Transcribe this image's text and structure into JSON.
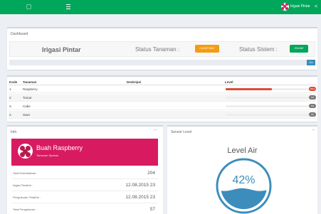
{
  "navbar": {
    "user_name": "Irigasi Pintar",
    "share_icon": "share-icon"
  },
  "dashboard": {
    "section_title": "Dashboard",
    "brand": "Irigasi Pintar",
    "status_tanaman_label": "Status Tanaman :",
    "status_tanaman_value": "CUKUP BAIK",
    "status_sistem_label": "Status Sistem :",
    "status_sistem_value": "ONLINE",
    "search_button": "Go"
  },
  "table": {
    "headers": {
      "no": "Kode",
      "name": "Tanaman",
      "desc": "Deskripsi",
      "level": "Level"
    },
    "rows": [
      {
        "no": "1.",
        "name": "Raspberry",
        "level_pct": 0.55,
        "badge": "55%",
        "color": "#dd4b39"
      },
      {
        "no": "2.",
        "name": "Tomat",
        "level_pct": 0,
        "badge": "0%",
        "color": "#777777"
      },
      {
        "no": "3.",
        "name": "Cabe",
        "level_pct": 0,
        "badge": "0%",
        "color": "#777777"
      },
      {
        "no": "4.",
        "name": "Sawi",
        "level_pct": 0,
        "badge": "0%",
        "color": "#777777"
      }
    ]
  },
  "info": {
    "title": "Info",
    "widget_name": "Buah Raspberry",
    "widget_sub": "Tanaman Spesial",
    "rows": [
      {
        "label": "Total Kelembaban :",
        "value": "204"
      },
      {
        "label": "Irigasi Terakhir :",
        "value": "12.08.2015 23"
      },
      {
        "label": "Pengukuran Terakhir :",
        "value": "12.08.2015 23"
      },
      {
        "label": "Total Pengukuran :",
        "value": "57"
      }
    ]
  },
  "sensor": {
    "title": "Sensor Level",
    "label": "Level Air",
    "value_text": "42%",
    "value_fraction": 0.42,
    "accent": "#3c8dbc"
  },
  "colors": {
    "header": "#00a65a",
    "widget": "#d81b60",
    "warning": "#f39c12",
    "success": "#00a65a"
  }
}
